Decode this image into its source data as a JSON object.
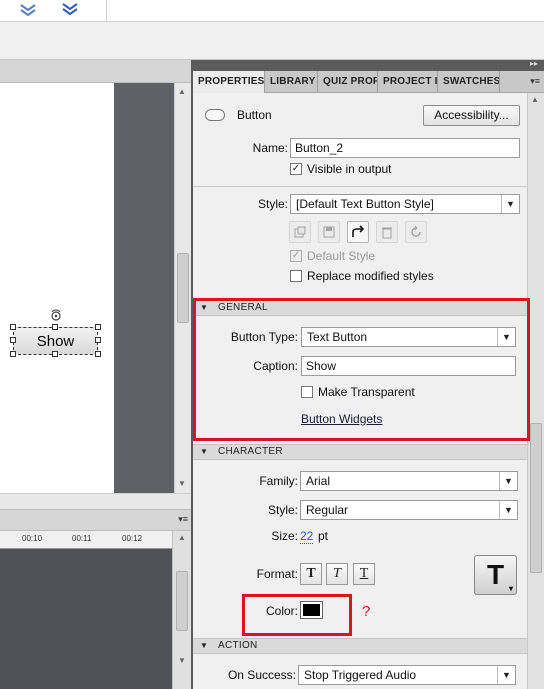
{
  "tabs": [
    {
      "label": "PROPERTIES"
    },
    {
      "label": "LIBRARY"
    },
    {
      "label": "QUIZ PROP"
    },
    {
      "label": "PROJECT IN"
    },
    {
      "label": "SWATCHES"
    }
  ],
  "object": {
    "type_label": "Button",
    "accessibility_label": "Accessibility...",
    "name_label": "Name:",
    "name_value": "Button_2",
    "visible_label": "Visible in output",
    "visible_checked": true,
    "style_label": "Style:",
    "style_value": "[Default Text Button Style]",
    "default_style_label": "Default Style",
    "replace_label": "Replace modified styles"
  },
  "general": {
    "header": "GENERAL",
    "button_type_label": "Button Type:",
    "button_type_value": "Text Button",
    "caption_label": "Caption:",
    "caption_value": "Show",
    "transparent_label": "Make Transparent",
    "widgets_link": "Button Widgets"
  },
  "character": {
    "header": "CHARACTER",
    "family_label": "Family:",
    "family_value": "Arial",
    "style_label": "Style:",
    "style_value": "Regular",
    "size_label": "Size:",
    "size_value": "22",
    "size_unit": "pt",
    "format_label": "Format:",
    "format_bold": "T",
    "format_italic": "T",
    "format_underline": "T",
    "text_icon": "T",
    "color_label": "Color:",
    "color_value": "#000000",
    "question_mark": "?"
  },
  "action": {
    "header": "ACTION",
    "on_success_label": "On Success:",
    "on_success_value": "Stop Triggered Audio"
  },
  "stage": {
    "button_caption": "Show"
  },
  "timeline": {
    "ticks": [
      "00:10",
      "00:11",
      "00:12"
    ]
  },
  "colors": {
    "highlight": "#d3162a",
    "stage_gray": "#5f6166",
    "timeline_bg": "#505257"
  }
}
